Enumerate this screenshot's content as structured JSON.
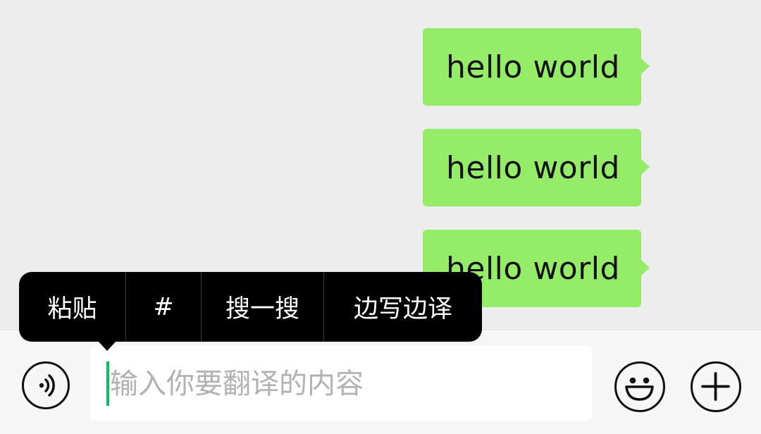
{
  "messages": [
    {
      "text": "hello world",
      "sender": "self"
    },
    {
      "text": "hello world",
      "sender": "self"
    },
    {
      "text": "hello world",
      "sender": "self"
    }
  ],
  "context_menu": {
    "items": [
      "粘贴",
      "#",
      "搜一搜",
      "边写边译"
    ]
  },
  "input": {
    "placeholder": "输入你要翻译的内容",
    "value": ""
  },
  "icons": {
    "voice": "voice-icon",
    "emoji": "smiley-icon",
    "more": "plus-icon"
  },
  "colors": {
    "bubble": "#95ec69",
    "caret": "#07c160",
    "background": "#ededed",
    "menu": "#000000"
  }
}
